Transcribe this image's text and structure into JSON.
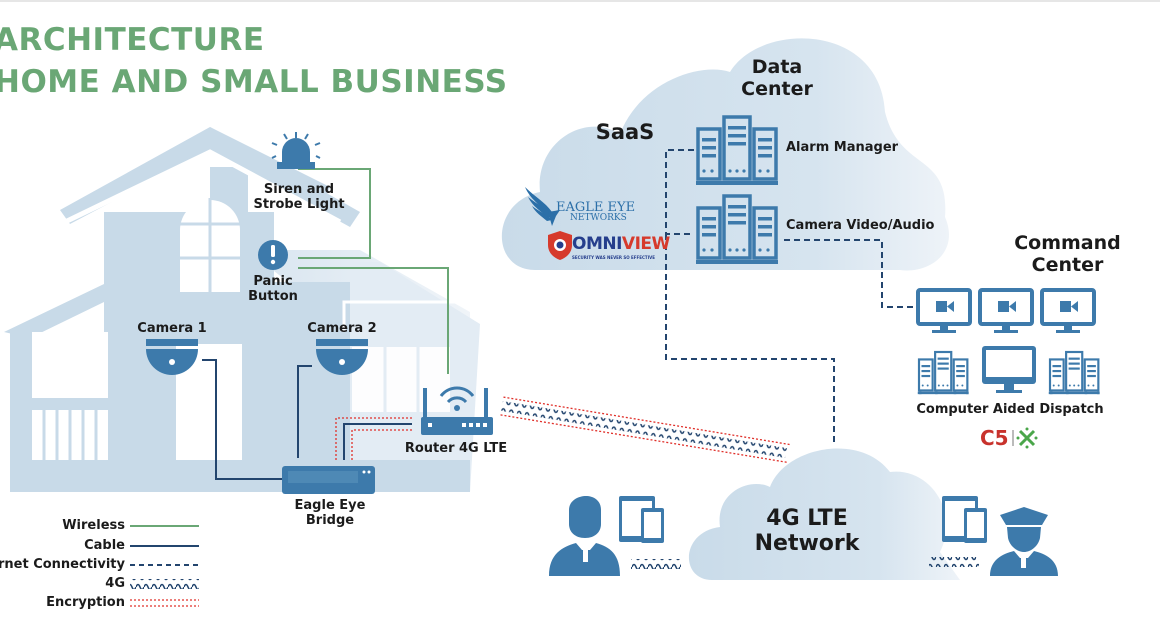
{
  "title": {
    "line1": "ARCHITECTURE",
    "line2": "HOME AND SMALL BUSINESS"
  },
  "colors": {
    "title_green": "#6aa775",
    "icon_blue": "#3d7aab",
    "house_fill": "#c8dae8",
    "cloud_fill": "#cfdfeb",
    "wireless": "#6aa775",
    "cable": "#23456e",
    "internet": "#23456e",
    "encryption": "#e0302a",
    "omniview_red": "#d63a2c",
    "c5_red": "#c8322c",
    "cdmx_green": "#4aa64a"
  },
  "house": {
    "siren_label_1": "Siren and",
    "siren_label_2": "Strobe Light",
    "panic_label_1": "Panic",
    "panic_label_2": "Button",
    "camera1_label": "Camera 1",
    "camera2_label": "Camera 2",
    "router_label": "Router 4G LTE",
    "bridge_label_1": "Eagle Eye",
    "bridge_label_2": "Bridge"
  },
  "cloud": {
    "saas_label": "SaaS",
    "datacenter_label_1": "Data",
    "datacenter_label_2": "Center",
    "alarm_manager_label": "Alarm Manager",
    "camera_video_label": "Camera Video/Audio",
    "eagle_eye_logo_1": "EAGLE EYE",
    "eagle_eye_logo_2": "NETWORKS",
    "omniview_logo_a": "OMNI",
    "omniview_logo_b": "VIEW",
    "omniview_tagline": "SECURITY WAS NEVER SO EFFECTIVE"
  },
  "command_center": {
    "label_1": "Command",
    "label_2": "Center",
    "cad_label": "Computer Aided Dispatch",
    "c5_logo": "C5",
    "monitors": 3,
    "server_racks": 2
  },
  "network": {
    "label_1": "4G LTE",
    "label_2": "Network"
  },
  "legend": {
    "items": [
      {
        "label": "Wireless",
        "style": "solid-green"
      },
      {
        "label": "Cable",
        "style": "solid-navy"
      },
      {
        "label": "Internet Connectivity",
        "style": "dashed-navy"
      },
      {
        "label": "4G",
        "style": "wave"
      },
      {
        "label": "Encryption",
        "style": "dotted-red"
      }
    ]
  },
  "icons": {
    "siren": "siren-icon",
    "panic": "exclamation-icon",
    "camera": "dome-camera-icon",
    "router": "wifi-router-icon",
    "bridge": "bridge-device-icon",
    "server": "server-rack-icon",
    "monitor": "video-monitor-icon",
    "user": "business-user-icon",
    "police": "police-officer-icon",
    "devices": "tablet-phone-icon"
  }
}
